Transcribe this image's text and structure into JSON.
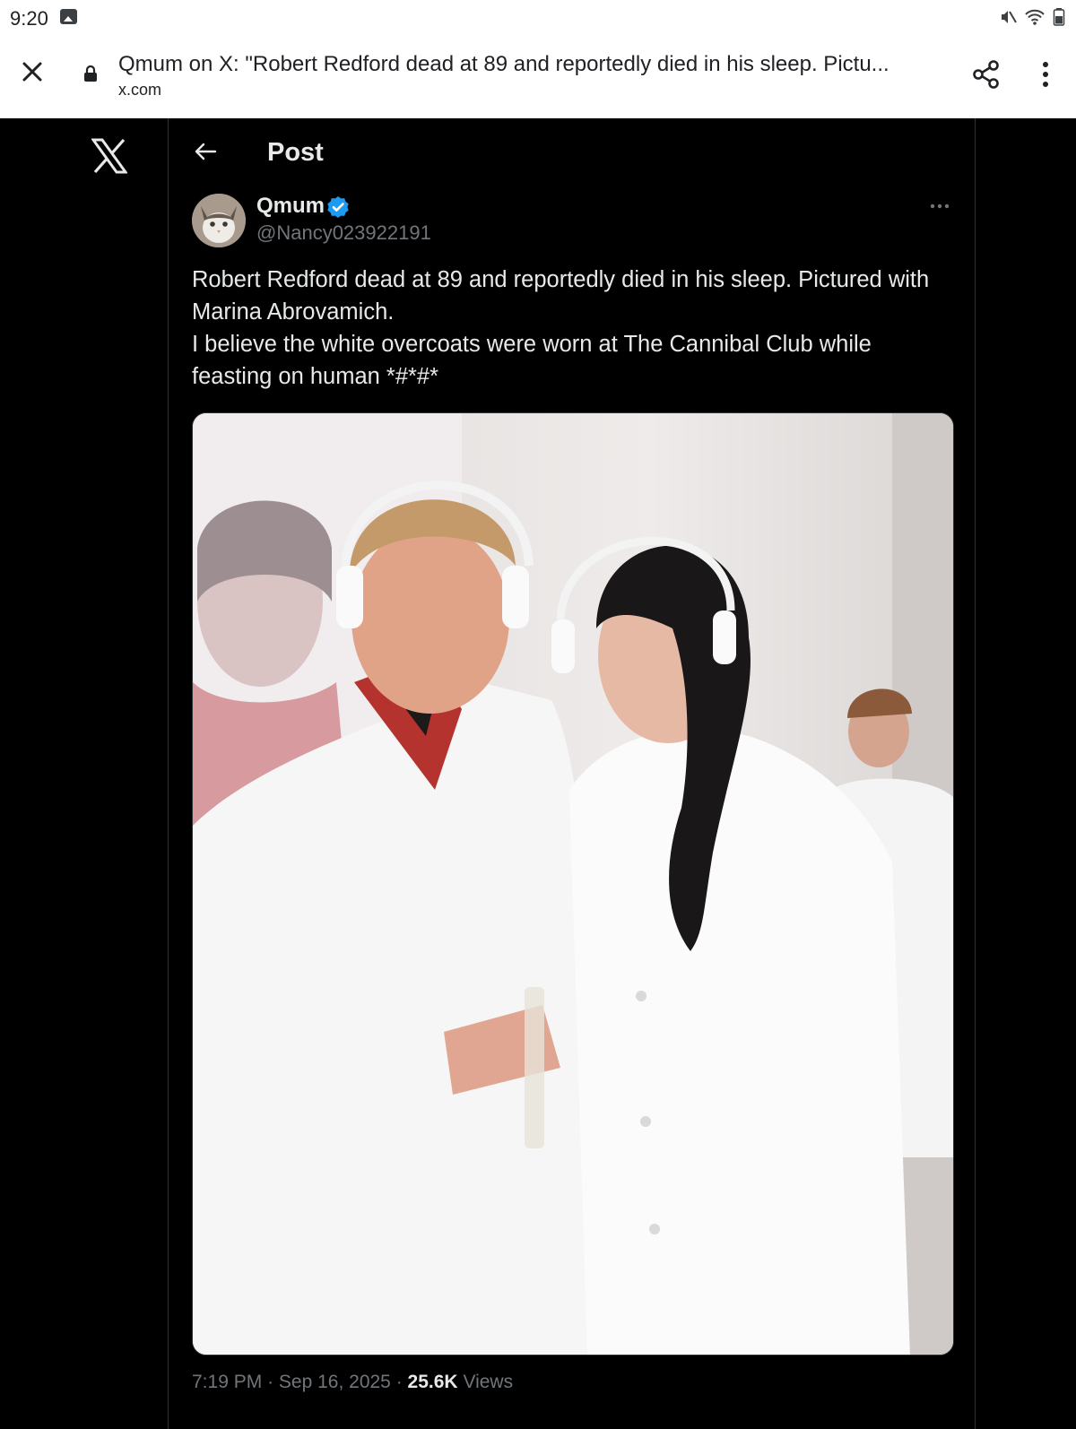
{
  "status_bar": {
    "time": "9:20",
    "icons": [
      "gallery-icon",
      "mute-icon",
      "wifi-icon",
      "battery-icon"
    ]
  },
  "browser": {
    "tab_title": "Qmum on X: \"Robert Redford dead at 89 and reportedly died in his sleep. Pictu...",
    "url": "x.com",
    "icons": [
      "close-icon",
      "lock-icon",
      "share-icon",
      "more-vert-icon"
    ]
  },
  "page": {
    "header_title": "Post",
    "icons": [
      "x-logo-icon",
      "back-arrow-icon"
    ]
  },
  "post": {
    "author_name": "Qmum",
    "handle": "@Nancy023922191",
    "verified": true,
    "verified_color": "#1d9bf0",
    "text_lines": [
      "Robert Redford dead at 89 and reportedly died in his sleep. Pictured with Marina Abrovamich.",
      "I believe the white overcoats were worn at The Cannibal Club while feasting on human *#*#*"
    ],
    "time": "7:19 PM",
    "separator": "·",
    "date": "Sep 16, 2025",
    "views_count": "25.6K",
    "views_label": "Views"
  }
}
